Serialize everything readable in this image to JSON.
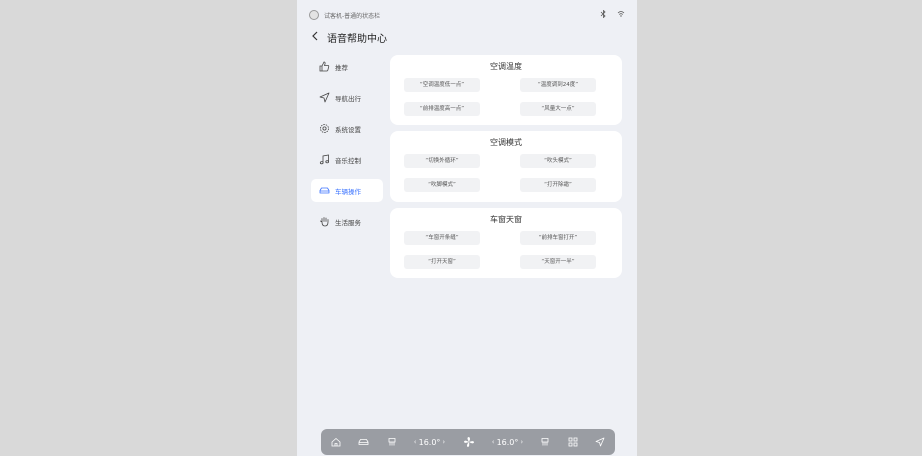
{
  "status": {
    "user_name": "试客机-普通的状态栏"
  },
  "header": {
    "title": "语音帮助中心"
  },
  "sidebar": {
    "items": [
      {
        "label": "推荐"
      },
      {
        "label": "导航出行"
      },
      {
        "label": "系统设置"
      },
      {
        "label": "音乐控制"
      },
      {
        "label": "车辆操作"
      },
      {
        "label": "生活服务"
      }
    ],
    "active_index": 4
  },
  "cards": [
    {
      "title": "空调温度",
      "chips": [
        "“空调温度低一点”",
        "“温度调到24度”",
        "“前排温度高一点”",
        "“风量大一点”"
      ]
    },
    {
      "title": "空调模式",
      "chips": [
        "“切换外循环”",
        "“吹头模式”",
        "“吹脚模式”",
        "“打开除霜”"
      ]
    },
    {
      "title": "车窗天窗",
      "chips": [
        "“车窗开条缝”",
        "“前排车窗打开”",
        "“打开天窗”",
        "“天窗开一半”"
      ]
    }
  ],
  "dock": {
    "left_temp": "16.0°",
    "right_temp": "16.0°",
    "left_arrow": "‹",
    "right_arrow": "›"
  },
  "colors": {
    "accent": "#3c74ff",
    "dock": "#9a9da3",
    "background": "#eef0f5"
  }
}
